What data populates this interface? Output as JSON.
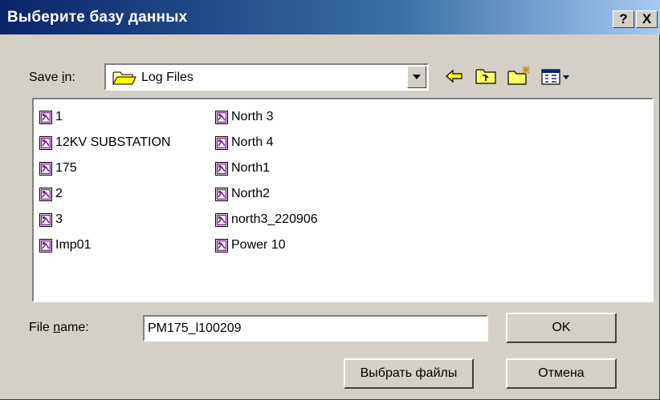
{
  "dialog": {
    "title": "Выберите базу данных",
    "help_label": "?",
    "close_label": "X"
  },
  "save_in": {
    "label_pre": "Save ",
    "label_accel": "i",
    "label_post": "n:",
    "folder": "Log Files"
  },
  "toolbar": {
    "icons": [
      "back-arrow-icon",
      "up-folder-icon",
      "new-folder-icon",
      "view-menu-icon"
    ]
  },
  "files": {
    "column1": [
      "1",
      "12KV SUBSTATION",
      "175",
      "2",
      "3",
      "Imp01"
    ],
    "column2": [
      "North 3",
      "North 4",
      "North1",
      "North2",
      "north3_220906",
      "Power 10"
    ]
  },
  "file_name": {
    "label_pre": "File ",
    "label_accel": "n",
    "label_post": "ame:",
    "value": "PM175_l100209"
  },
  "buttons": {
    "ok": "OK",
    "select_files": "Выбрать файлы",
    "cancel": "Отмена"
  },
  "colors": {
    "title_start": "#0a246a",
    "title_end": "#a6caf0",
    "face": "#d4d0c8",
    "file_icon": "#7b2b8f"
  }
}
